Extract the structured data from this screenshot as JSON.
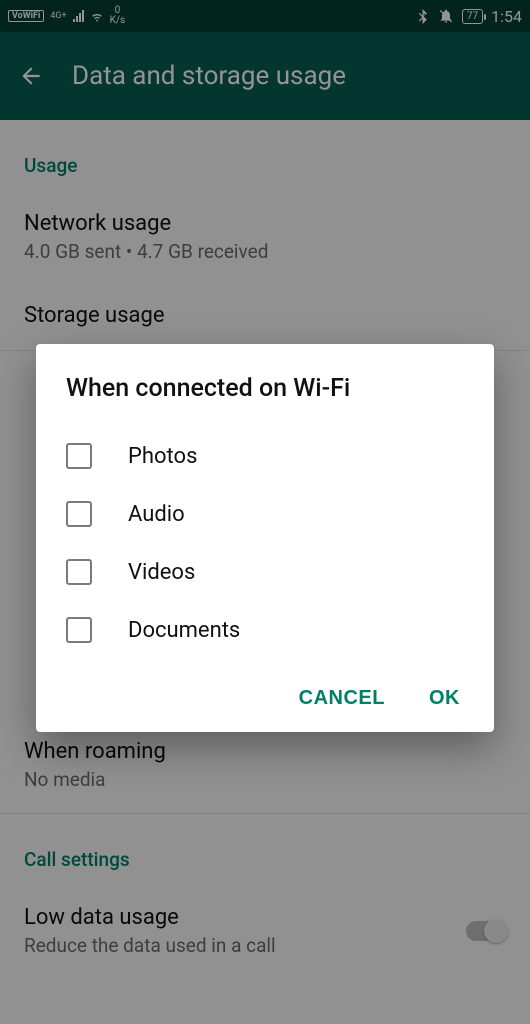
{
  "statusBar": {
    "vowifi": "VoWiFi",
    "networkType": "4G+",
    "speedValue": "0",
    "speedUnit": "K/s",
    "battery": "77",
    "time": "1:54"
  },
  "appBar": {
    "title": "Data and storage usage"
  },
  "sections": {
    "usage": {
      "header": "Usage",
      "network": {
        "title": "Network usage",
        "sub": "4.0 GB sent • 4.7 GB received"
      },
      "storage": {
        "title": "Storage usage"
      }
    },
    "roaming": {
      "title": "When roaming",
      "sub": "No media"
    },
    "call": {
      "header": "Call settings",
      "lowData": {
        "title": "Low data usage",
        "sub": "Reduce the data used in a call"
      }
    }
  },
  "dialog": {
    "title": "When connected on Wi-Fi",
    "options": {
      "photos": "Photos",
      "audio": "Audio",
      "videos": "Videos",
      "documents": "Documents"
    },
    "cancel": "CANCEL",
    "ok": "OK"
  }
}
